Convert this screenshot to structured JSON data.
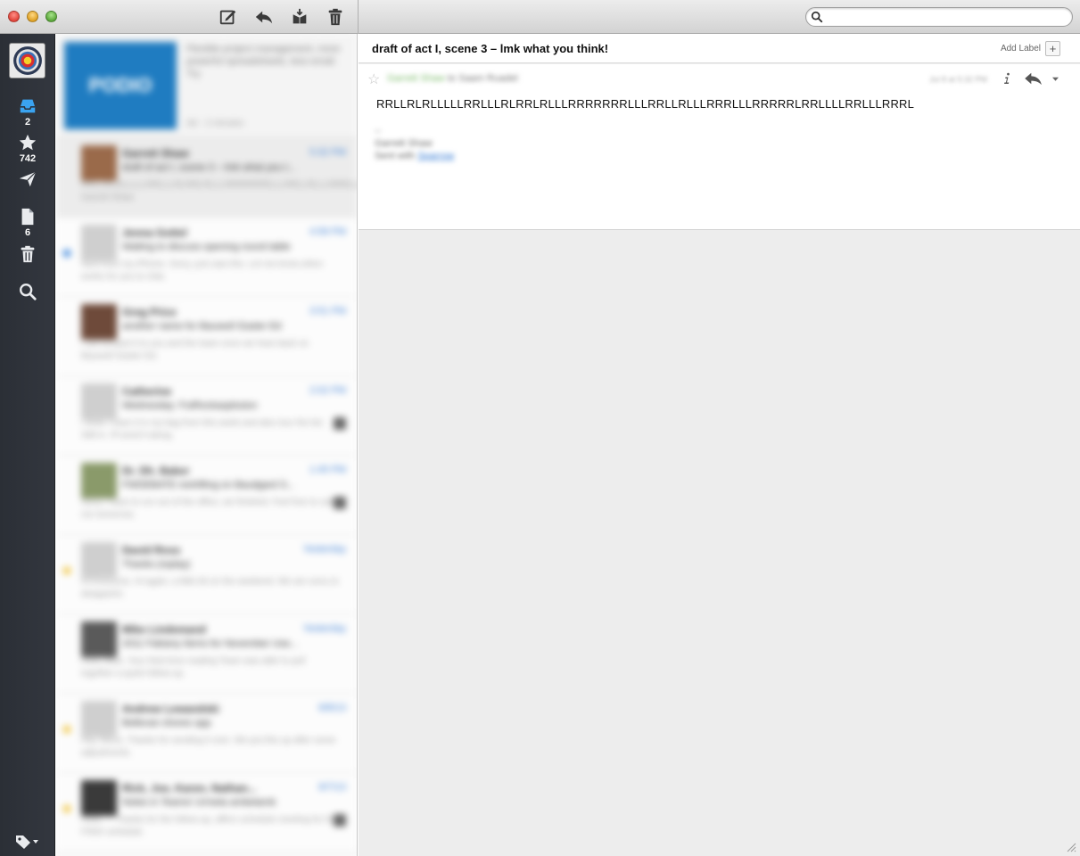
{
  "window": {
    "toolbar": {
      "compose_icon": "compose-icon",
      "reply_icon": "reply-icon",
      "archive_icon": "archive-icon",
      "trash_icon": "trash-icon"
    },
    "search": {
      "placeholder": "",
      "value": ""
    }
  },
  "sidebar": {
    "inbox": {
      "icon": "inbox-icon",
      "count": "2"
    },
    "starred": {
      "icon": "star-icon",
      "count": "742"
    },
    "sent": {
      "icon": "paper-plane-icon"
    },
    "drafts": {
      "icon": "document-icon",
      "count": "6"
    },
    "trash": {
      "icon": "trash-icon"
    },
    "search": {
      "icon": "search-icon"
    },
    "tags": {
      "icon": "tag-icon"
    }
  },
  "message_list": {
    "promo": {
      "logo_text": "PODIO",
      "text": "Flexible project management, more powerful spreadsheets, less email. Try",
      "date": "Ad · 2 minutes"
    },
    "messages": [
      {
        "from": "Garrett Shaw",
        "date": "5:32 PM",
        "subject": "draft of act I, scene 3 – lmk what you t...",
        "preview": "RRLLRLRLLLLLRRLLLRLRRLRLLLRRRRRRRLLLRRLLRLLLRRRLLLRRRRRLRRLLLLRRLLLRRRL Garrett Shaw",
        "flag": "",
        "attachment": false,
        "selected": true
      },
      {
        "from": "Jenna Gottel",
        "date": "4:58 PM",
        "subject": "Waiting to discuss opening round table",
        "preview": "Sent from my iPhone. Sorry, just saw this. Let me know when works for you to chat.",
        "flag": "#4a8fe0",
        "attachment": false,
        "selected": false
      },
      {
        "from": "Greg Price",
        "date": "3:51 PM",
        "subject": "another name for Baused! Easter Ed",
        "preview": "I will forward it to you and the team once we hear back on Baused! Easter Ed.",
        "flag": "",
        "attachment": false,
        "selected": false
      },
      {
        "from": "Catherine",
        "date": "2:02 PM",
        "subject": "Wednesday: FutRockasplosion",
        "preview": "I think I have it in my bag from this week and also tour the list. Still in. I'll send it along.",
        "flag": "",
        "attachment": true,
        "selected": false
      },
      {
        "from": "Dr. Dh. Baker",
        "date": "1:45 PM",
        "subject": "FWDEBATE reshifting on Baudgard S...",
        "preview": "Sorry I have to run out of the office, we finished. Feel free to call me tomorrow.",
        "flag": "",
        "attachment": true,
        "selected": false
      },
      {
        "from": "David Ross",
        "date": "Yesterday",
        "subject": "Thanks (replay)",
        "preview": "Hi Everyone, Hi again, a little bit on the weekend. We are sorry to disappoint.",
        "flag": "#f2c94c",
        "attachment": false,
        "selected": false
      },
      {
        "from": "Mike Lindemand",
        "date": "Yesterday",
        "subject": "2011 Fabiany Items for November Use...",
        "preview": "Hello Mike, Your third time reading Team was able to pull together a quick follow-up.",
        "flag": "",
        "attachment": false,
        "selected": false
      },
      {
        "from": "Andrew Lewandski",
        "date": "8/8/13",
        "subject": "Bellevan shores app",
        "preview": "Hey Steve, Thanks for sending it over. We put this up after some adjustments.",
        "flag": "#f2c94c",
        "attachment": false,
        "selected": false
      },
      {
        "from": "Rick, Joe, Karen, Nathan...",
        "date": "8/7/13",
        "subject": "Notes in Teams! Urmeta ambelamb",
        "preview": "Hello — Thanks for the follow-up, affirm schedule meeting for the FINIX schedule.",
        "flag": "#f2c94c",
        "attachment": true,
        "selected": false
      }
    ]
  },
  "reader": {
    "subject": "draft of act I, scene 3 – lmk what you think!",
    "add_label": "Add Label",
    "add_label_button": "+",
    "sender_name": "Garrett Shaw",
    "sender_to": "to Saam Ruadel",
    "sent_time": "Jul 8 at 5:32 PM",
    "info_icon": "info-icon",
    "reply_icon": "reply-icon",
    "more_icon": "chevron-down-icon",
    "body": "RRLLRLRLLLLLRRLLLRLRRLRLLLRRRRRRRLLLRRLLRLLLRRRLLLRRRRRLRRLLLLRRLLLRRRL",
    "signature": {
      "dash": "--",
      "name": "Garrett Shaw",
      "prefix": "Sent with",
      "link": "Sparrow"
    }
  }
}
